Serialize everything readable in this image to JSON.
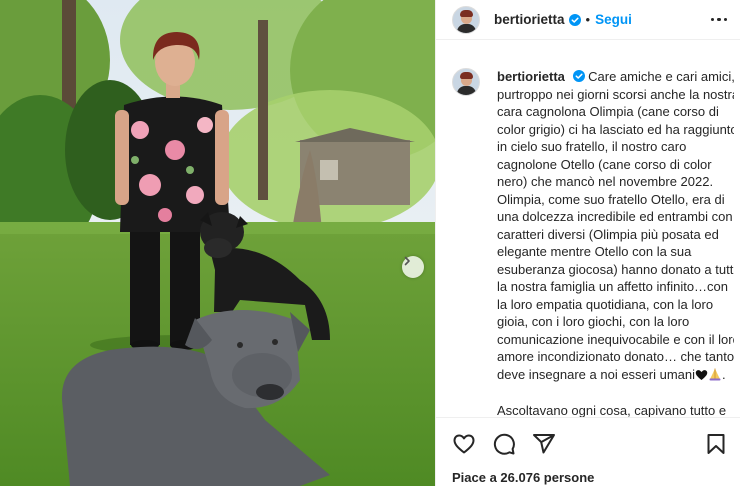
{
  "post": {
    "username": "bertiorietta",
    "separator": "•",
    "follow_label": "Segui",
    "caption_paragraphs": [
      "Care amiche e cari amici, purtroppo nei giorni scorsi anche la nostra cara cagnolona Olimpia (cane corso di color grigio) ci ha lasciato ed ha raggiunto in cielo suo fratello, il nostro caro cagnolone Otello (cane corso di color nero) che mancò nel novembre 2022. Olimpia, come suo fratello Otello, era di una dolcezza incredibile ed entrambi con caratteri diversi (Olimpia più posata ed elegante mentre Otello con la sua esuberanza giocosa) hanno donato a tutta la nostra famiglia un affetto infinito…con la loro empatia quotidiana, con la loro gioia, con i loro giochi, con la loro comunicazione inequivocabile e con il loro amore incondizionato donato… che tanto deve insegnare a noi esseri umani",
      "Ascoltavano ogni cosa, capivano tutto e"
    ],
    "caption_emojis": [
      "black-heart-icon",
      "praying-hands-icon"
    ],
    "likes_text": "Piace a 26.076 persone"
  },
  "icons": {
    "verified": "verified-badge-icon",
    "more": "more-options-icon",
    "like": "heart-icon",
    "comment": "comment-icon",
    "share": "share-icon",
    "save": "bookmark-icon",
    "carousel_next": "chevron-right-icon"
  },
  "colors": {
    "accent": "#0095f6",
    "text": "#262626",
    "divider": "#efefef"
  }
}
